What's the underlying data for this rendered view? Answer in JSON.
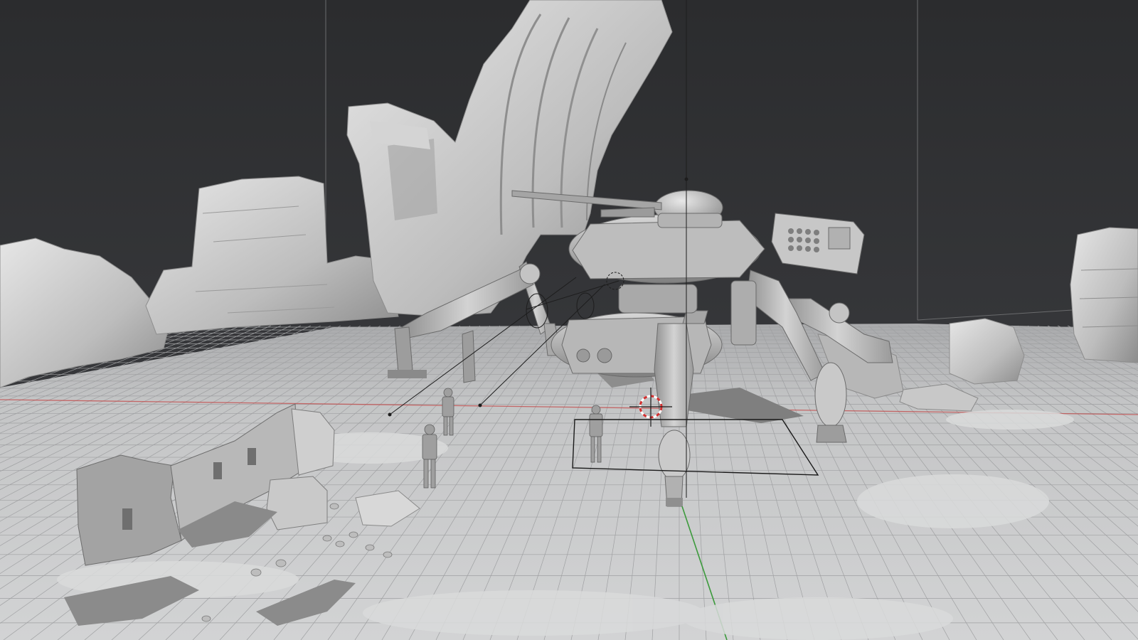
{
  "viewport": {
    "mode": "solid",
    "background_color": "#2e2f31",
    "floor_color": "#c9cacb",
    "grid_color": "#9fa0a2",
    "model_color": "#b9b9b9",
    "x_axis_color": "#c44848",
    "y_axis_color": "#3c9a3c",
    "cursor_color": "#d22f2f"
  }
}
